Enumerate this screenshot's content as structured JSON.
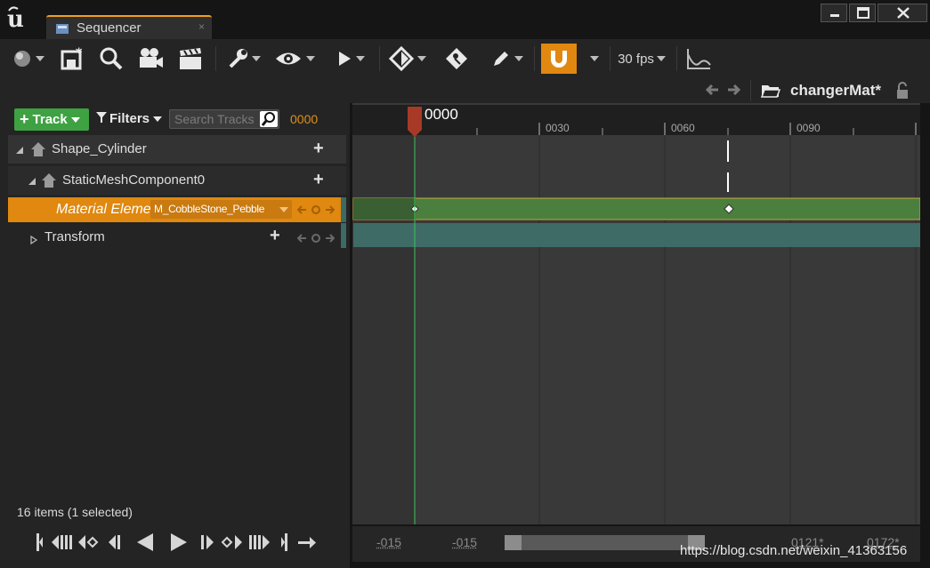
{
  "window": {
    "tab_title": "Sequencer",
    "tab_close": "×"
  },
  "toolbar": {
    "fps": "30 fps",
    "buttons": [
      "world-icon",
      "save-icon",
      "search-icon",
      "camera-icon",
      "clapperboard-icon",
      "wrench-icon",
      "eye-icon",
      "play-icon",
      "key-icon",
      "key-tag-icon",
      "pencil-icon",
      "magnet-icon",
      "curve-icon"
    ],
    "snap_active_color": "#e0880f"
  },
  "nav": {
    "sequence_name": "changerMat*"
  },
  "left_panel": {
    "track_label": "Track",
    "filters_label": "Filters",
    "search_placeholder": "Search Tracks",
    "current_time": "0000",
    "rows": [
      {
        "label": "Shape_Cylinder"
      },
      {
        "label": "StaticMeshComponent0"
      },
      {
        "label": "Material Eleme",
        "value": "M_CobbleStone_Pebble"
      },
      {
        "label": "Transform"
      }
    ],
    "items_count": "16 items (1 selected)"
  },
  "timeline": {
    "playhead_time": "0000",
    "ticks": [
      "0030",
      "0060",
      "0090"
    ]
  },
  "bottom": {
    "range_start_a": "-015",
    "range_start_b": "-015",
    "range_end_a": "0121*",
    "range_end_b": "0172*"
  },
  "watermark": "https://blog.csdn.net/weixin_41363156"
}
